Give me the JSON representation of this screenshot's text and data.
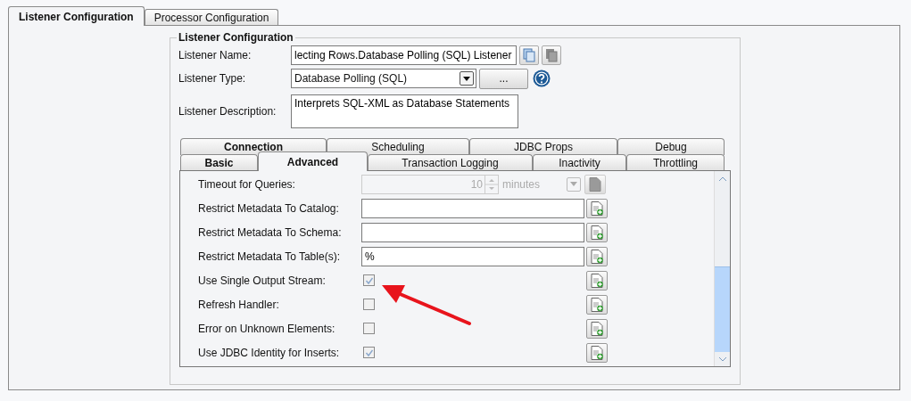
{
  "outer_tabs": [
    {
      "label": "Listener Configuration",
      "selected": true
    },
    {
      "label": "Processor Configuration",
      "selected": false
    }
  ],
  "listener_configuration": {
    "title": "Listener Configuration",
    "name_label": "Listener Name:",
    "name_value": "lecting Rows.Database Polling (SQL) Listener",
    "type_label": "Listener Type:",
    "type_value": "Database Polling (SQL)",
    "browse_button": "...",
    "description_label": "Listener Description:",
    "description_value": "Interprets SQL-XML as Database Statements"
  },
  "inner_tabs": {
    "back_row": [
      {
        "label": "Connection",
        "selected": false
      },
      {
        "label": "Scheduling",
        "selected": false
      },
      {
        "label": "JDBC Props",
        "selected": false
      },
      {
        "label": "Debug",
        "selected": false
      }
    ],
    "front_row": [
      {
        "label": "Basic",
        "selected": false
      },
      {
        "label": "Advanced",
        "selected": true
      },
      {
        "label": "Transaction Logging",
        "selected": false
      },
      {
        "label": "Inactivity",
        "selected": false
      },
      {
        "label": "Throttling",
        "selected": false
      }
    ]
  },
  "settings": [
    {
      "kind": "spinner",
      "label": "Timeout for Queries:",
      "value": "10",
      "unit": "minutes",
      "disabled": true
    },
    {
      "kind": "text",
      "label": "Restrict Metadata To Catalog:"
    },
    {
      "kind": "text",
      "label": "Restrict Metadata To Schema:"
    },
    {
      "kind": "text",
      "label": "Restrict Metadata To Table(s):",
      "value": "%"
    },
    {
      "kind": "checkbox",
      "label": "Use Single Output Stream:",
      "checked": true
    },
    {
      "kind": "checkbox",
      "label": "Refresh Handler:",
      "checked": false
    },
    {
      "kind": "checkbox",
      "label": "Error on Unknown Elements:",
      "checked": false
    },
    {
      "kind": "checkbox",
      "label": "Use JDBC Identity for Inserts:",
      "checked": true
    }
  ]
}
